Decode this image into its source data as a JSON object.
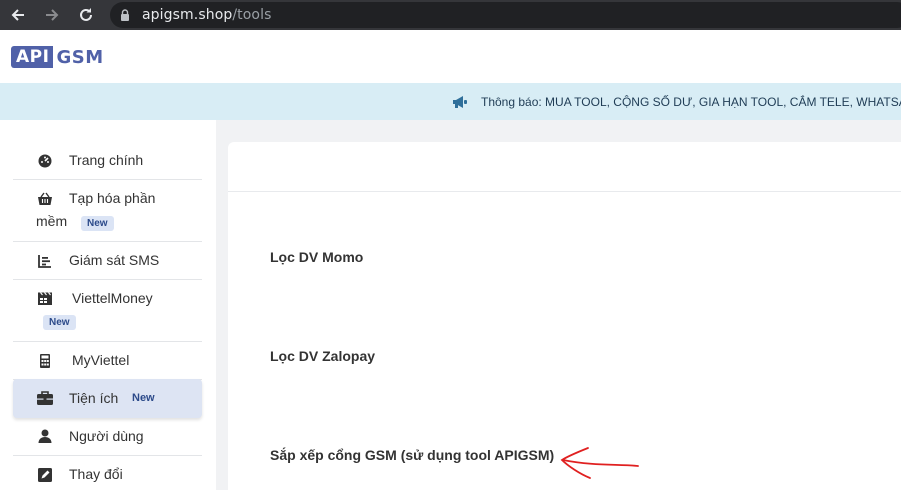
{
  "browser": {
    "url_domain": "apigsm.shop",
    "url_path": "/tools"
  },
  "header": {
    "logo_api": "API",
    "logo_gsm": "GSM"
  },
  "notice": {
    "text": "Thông báo: MUA TOOL, CỘNG SỐ DƯ, GIA HẠN TOOL, CẮM TELE, WHATSAPP"
  },
  "sidebar": {
    "badge": "New",
    "items": [
      {
        "line1": "Trang chính",
        "icon": "dashboard-icon"
      },
      {
        "line1": "Tạp hóa phần",
        "line2": "mềm",
        "icon": "basket-icon"
      },
      {
        "line1": "Giám sát SMS",
        "icon": "chart-icon"
      },
      {
        "line1": "ViettelMoney",
        "icon": "film-icon"
      },
      {
        "line1": "MyViettel",
        "icon": "calculator-icon"
      },
      {
        "line1": "Tiện ích",
        "icon": "toolbox-icon"
      },
      {
        "line1": "Người dùng",
        "icon": "user-icon"
      },
      {
        "line1": "Thay đổi",
        "icon": "edit-icon"
      }
    ]
  },
  "main": {
    "tools": [
      {
        "label": "Lọc DV Momo"
      },
      {
        "label": "Lọc DV Zalopay"
      },
      {
        "label": "Sắp xếp cổng GSM (sử dụng tool APIGSM)"
      }
    ]
  },
  "colors": {
    "brand": "#5061a8",
    "notice_bg": "#d8edf5",
    "active_bg": "#dde4f3",
    "annotation_arrow": "#e02020"
  }
}
